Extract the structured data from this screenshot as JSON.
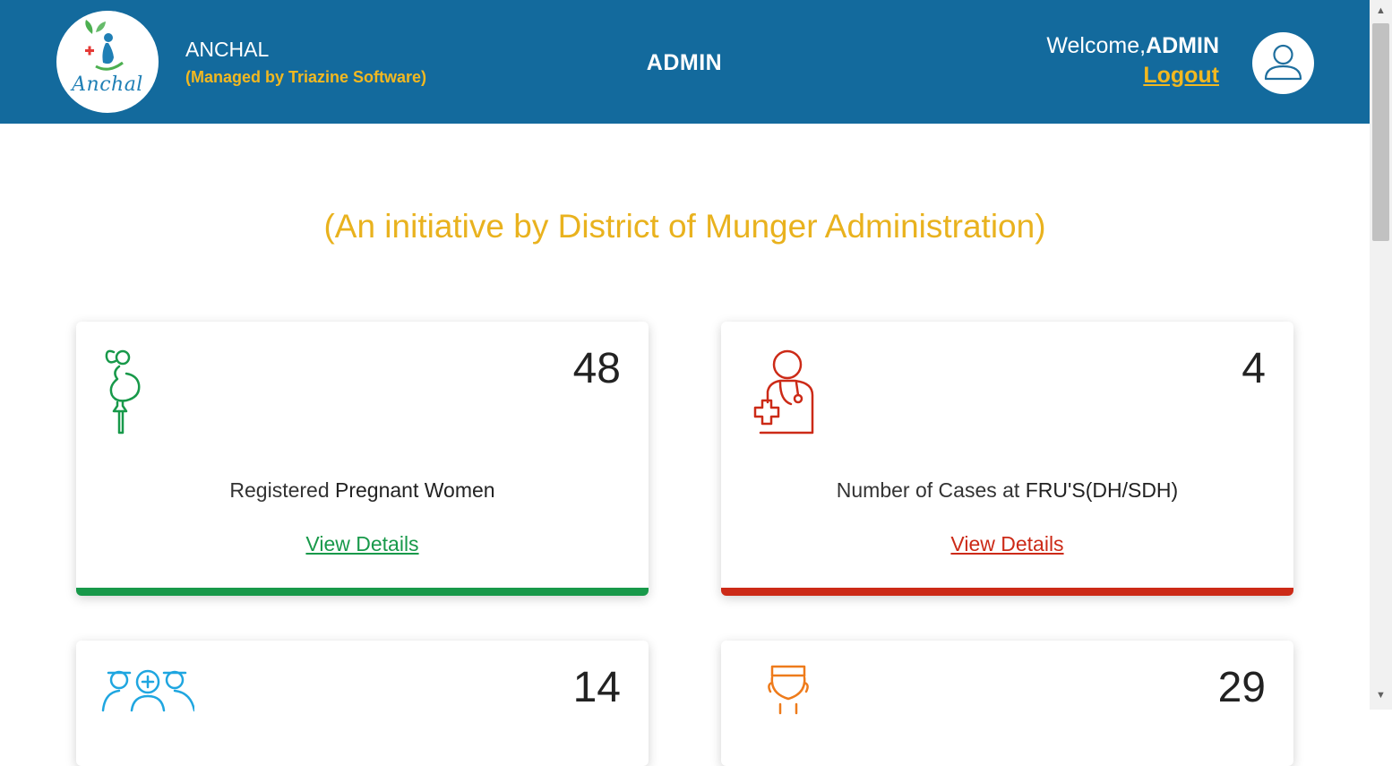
{
  "header": {
    "logo_text": "Anchal",
    "app_name": "ANCHAL",
    "managed_by": "(Managed by Triazine Software)",
    "role_title": "ADMIN",
    "welcome_prefix": "Welcome,",
    "username": "ADMIN",
    "logout_label": "Logout",
    "background_color": "#136a9d",
    "accent_color": "#f2b820"
  },
  "initiative_text": "(An initiative by District of Munger Administration)",
  "cards": [
    {
      "icon": "pregnant-woman-icon",
      "count": "48",
      "label_plain": "Registered ",
      "label_emph": "Pregnant Women",
      "link": "View Details",
      "color": "#18994a"
    },
    {
      "icon": "doctor-icon",
      "count": "4",
      "label_plain": "Number of Cases at ",
      "label_emph": "FRU'S(DH/SDH)",
      "link": "View Details",
      "color": "#cc2a17"
    },
    {
      "icon": "medical-team-icon",
      "count": "14",
      "color": "#1fa6e0"
    },
    {
      "icon": "health-worker-icon",
      "count": "29",
      "color": "#ee7b1b"
    }
  ]
}
